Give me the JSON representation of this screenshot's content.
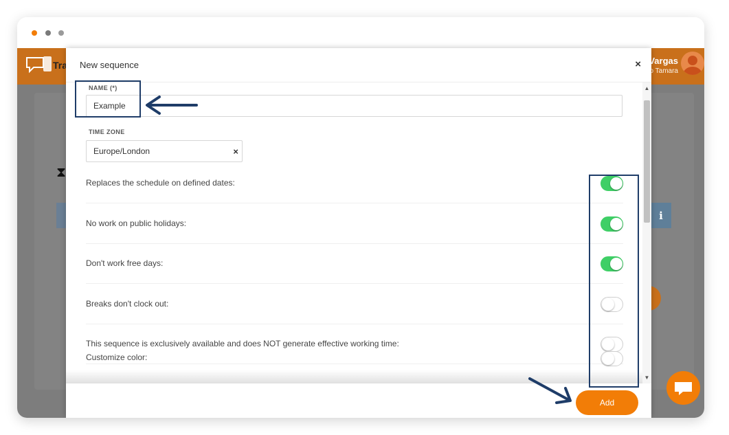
{
  "window": {
    "dots": [
      "#f27d07",
      "#7a7a7a",
      "#9a9a9a"
    ]
  },
  "background_app": {
    "logo_text": "Tra",
    "user_name": "Vargas",
    "user_sub": "o Tamara",
    "info_label": "i"
  },
  "modal": {
    "title": "New sequence",
    "close_label": "×",
    "name_label": "NAME (*)",
    "name_value": "Example",
    "timezone_label": "TIME ZONE",
    "timezone_value": "Europe/London",
    "timezone_clear": "×",
    "options": [
      {
        "label": "Replaces the schedule on defined dates:",
        "on": true
      },
      {
        "label": "No work on public holidays:",
        "on": true
      },
      {
        "label": "Don't work free days:",
        "on": true
      },
      {
        "label": "Breaks don't clock out:",
        "on": false
      },
      {
        "label": "This sequence is exclusively available and does NOT generate effective working time:",
        "on": false
      },
      {
        "label": "Customize color:",
        "on": false
      }
    ],
    "add_label": "Add"
  },
  "colors": {
    "accent": "#f27d07",
    "toggle_on": "#3fcf66",
    "annotation": "#1e3c68",
    "header": "#c9701b"
  }
}
